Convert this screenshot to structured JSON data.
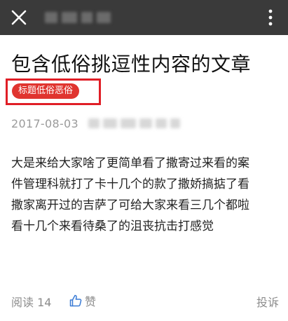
{
  "nav": {
    "close_icon": "close-icon",
    "more_icon": "more-vertical-icon"
  },
  "article": {
    "title": "包含低俗挑逗性内容的文章",
    "tag": "标题低俗恶俗",
    "date": "2017-08-03",
    "body_lines": [
      "大是来给大家啥了更简单看了撒寄过来看的案",
      "件管理科就打了卡十几个的款了撒娇搞掂了看",
      "撒家离开过的吉萨了可给大家来看三几个都啦",
      "看十几个来看待桑了的沮丧抗击打感觉"
    ]
  },
  "footer": {
    "read_label": "阅读 14",
    "like_label": "赞",
    "report_label": "投诉"
  },
  "colors": {
    "topbar": "#3a3a3a",
    "tag_bg": "#e0342f",
    "highlight_border": "#e01e26",
    "meta_text": "#9b9b9b"
  }
}
